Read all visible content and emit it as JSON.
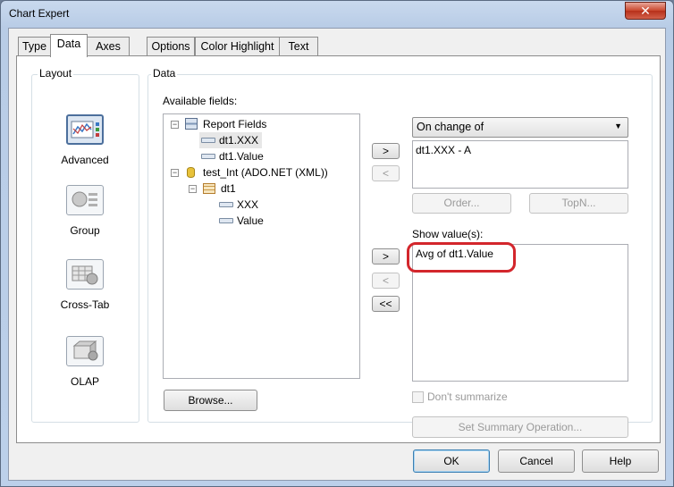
{
  "window": {
    "title": "Chart Expert",
    "close_glyph": "✕"
  },
  "tabs": [
    {
      "label": "Type"
    },
    {
      "label": "Data",
      "active": true
    },
    {
      "label": "Axes"
    },
    {
      "label": "Options"
    },
    {
      "label": "Color Highlight"
    },
    {
      "label": "Text"
    }
  ],
  "layout_group": {
    "label": "Layout",
    "items": [
      {
        "label": "Advanced",
        "icon": "advanced-chart-icon",
        "selected": true
      },
      {
        "label": "Group",
        "icon": "group-chart-icon"
      },
      {
        "label": "Cross-Tab",
        "icon": "cross-tab-chart-icon"
      },
      {
        "label": "OLAP",
        "icon": "olap-chart-icon"
      }
    ]
  },
  "data_group": {
    "label": "Data",
    "available_fields_label": "Available fields:",
    "tree": [
      {
        "label": "Report Fields",
        "expander": "−",
        "icon": "report-fields-icon"
      },
      {
        "label": "dt1.XXX",
        "icon": "field-icon",
        "selected": true
      },
      {
        "label": "dt1.Value",
        "icon": "field-icon"
      },
      {
        "label": "test_Int (ADO.NET (XML))",
        "expander": "−",
        "icon": "database-icon"
      },
      {
        "label": "dt1",
        "expander": "−",
        "icon": "table-icon"
      },
      {
        "label": "XXX",
        "icon": "field-icon"
      },
      {
        "label": "Value",
        "icon": "field-icon"
      }
    ],
    "browse_button": "Browse...",
    "on_change_combo": "On change of",
    "on_change_items": [
      "dt1.XXX - A"
    ],
    "order_button": "Order...",
    "topn_button": "TopN...",
    "show_values_label": "Show value(s):",
    "show_values_items": [
      "Avg of dt1.Value"
    ],
    "dont_summarize_label": "Don't summarize",
    "set_summary_button": "Set Summary Operation...",
    "add_button": ">",
    "remove_button": "<",
    "remove_all_button": "<<"
  },
  "footer": {
    "ok": "OK",
    "cancel": "Cancel",
    "help": "Help"
  },
  "colors": {
    "annotation_ring": "#d3262c",
    "title_bar": "#b8cce6"
  }
}
